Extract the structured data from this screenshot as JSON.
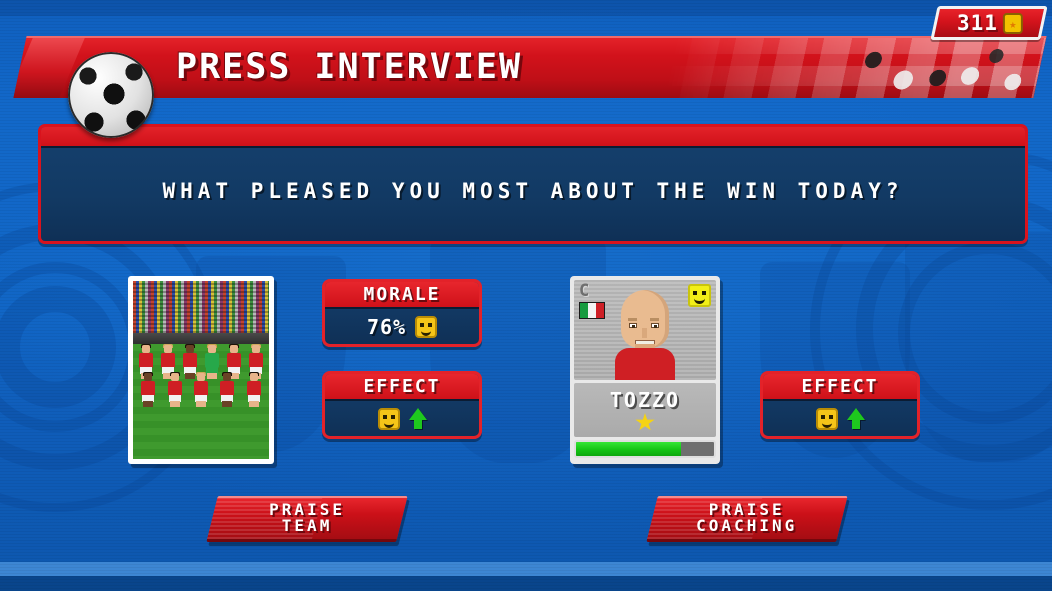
{
  "header": {
    "title": "PRESS INTERVIEW",
    "ball_icon": "soccer-ball-icon"
  },
  "currency": {
    "value": "311",
    "icon": "coin-icon"
  },
  "question": {
    "text": "WHAT PLEASED YOU MOST ABOUT THE WIN TODAY?"
  },
  "team_photo": {
    "alt": "team-squad-photo"
  },
  "morale_panel": {
    "title": "MORALE",
    "value": "76%",
    "icon": "happy-face-icon"
  },
  "effect_panel_left": {
    "title": "EFFECT",
    "icon": "happy-face-icon",
    "arrow": "arrow-up-icon"
  },
  "effect_panel_right": {
    "title": "EFFECT",
    "icon": "happy-face-icon",
    "arrow": "arrow-up-icon"
  },
  "player_card": {
    "name": "TOZZO",
    "captain_badge": "C",
    "nationality_flag": "italy-flag-icon",
    "mood_icon": "happy-face-icon",
    "star_icon": "star-icon",
    "bar_percent": 76
  },
  "buttons": {
    "praise_team_line1": "PRAISE",
    "praise_team_line2": "TEAM",
    "praise_coaching_line1": "PRAISE",
    "praise_coaching_line2": "COACHING"
  },
  "colors": {
    "red": "#d3131c",
    "blue_bg": "#1166c6",
    "panel_blue": "#123a64",
    "gold": "#f2c200",
    "green": "#14c414",
    "white": "#ffffff"
  }
}
